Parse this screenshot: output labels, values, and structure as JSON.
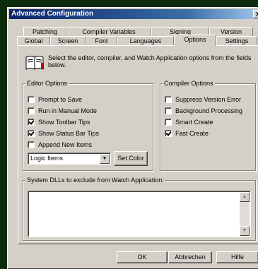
{
  "window": {
    "title": "Advanced Configuration",
    "close_glyph": "✕"
  },
  "tabs_back": [
    {
      "label": "Patching"
    },
    {
      "label": "Compiler Variables"
    },
    {
      "label": "Signing"
    },
    {
      "label": "Version"
    }
  ],
  "tabs_front": [
    {
      "label": "Global"
    },
    {
      "label": "Screen"
    },
    {
      "label": "Font"
    },
    {
      "label": "Languages"
    },
    {
      "label": "Options"
    },
    {
      "label": "Settings"
    }
  ],
  "intro": {
    "icon": "book-icon",
    "text": "Select the editor, compiler, and Watch Application options from the fields below."
  },
  "editor_options": {
    "title": "Editor Options",
    "items": [
      {
        "label": "Prompt to Save",
        "checked": false
      },
      {
        "label": "Run in Manual Mode",
        "checked": false
      },
      {
        "label": "Show Toolbar Tips",
        "checked": true
      },
      {
        "label": "Show Status Bar Tips",
        "checked": true
      },
      {
        "label": "Append New Items",
        "checked": false
      }
    ],
    "combo_value": "Logic Items",
    "set_color_label": "Set Color"
  },
  "compiler_options": {
    "title": "Compiler Options",
    "items": [
      {
        "label": "Suppress Version Error",
        "checked": false
      },
      {
        "label": "Background Processing",
        "checked": false
      },
      {
        "label": "Smart Create",
        "checked": false
      },
      {
        "label": "Fast Create",
        "checked": true
      }
    ]
  },
  "dlls": {
    "title": "System DLLs to exclude from Watch Application:"
  },
  "buttons": {
    "ok": "OK",
    "cancel": "Abbrechen",
    "help": "Hilfe"
  }
}
